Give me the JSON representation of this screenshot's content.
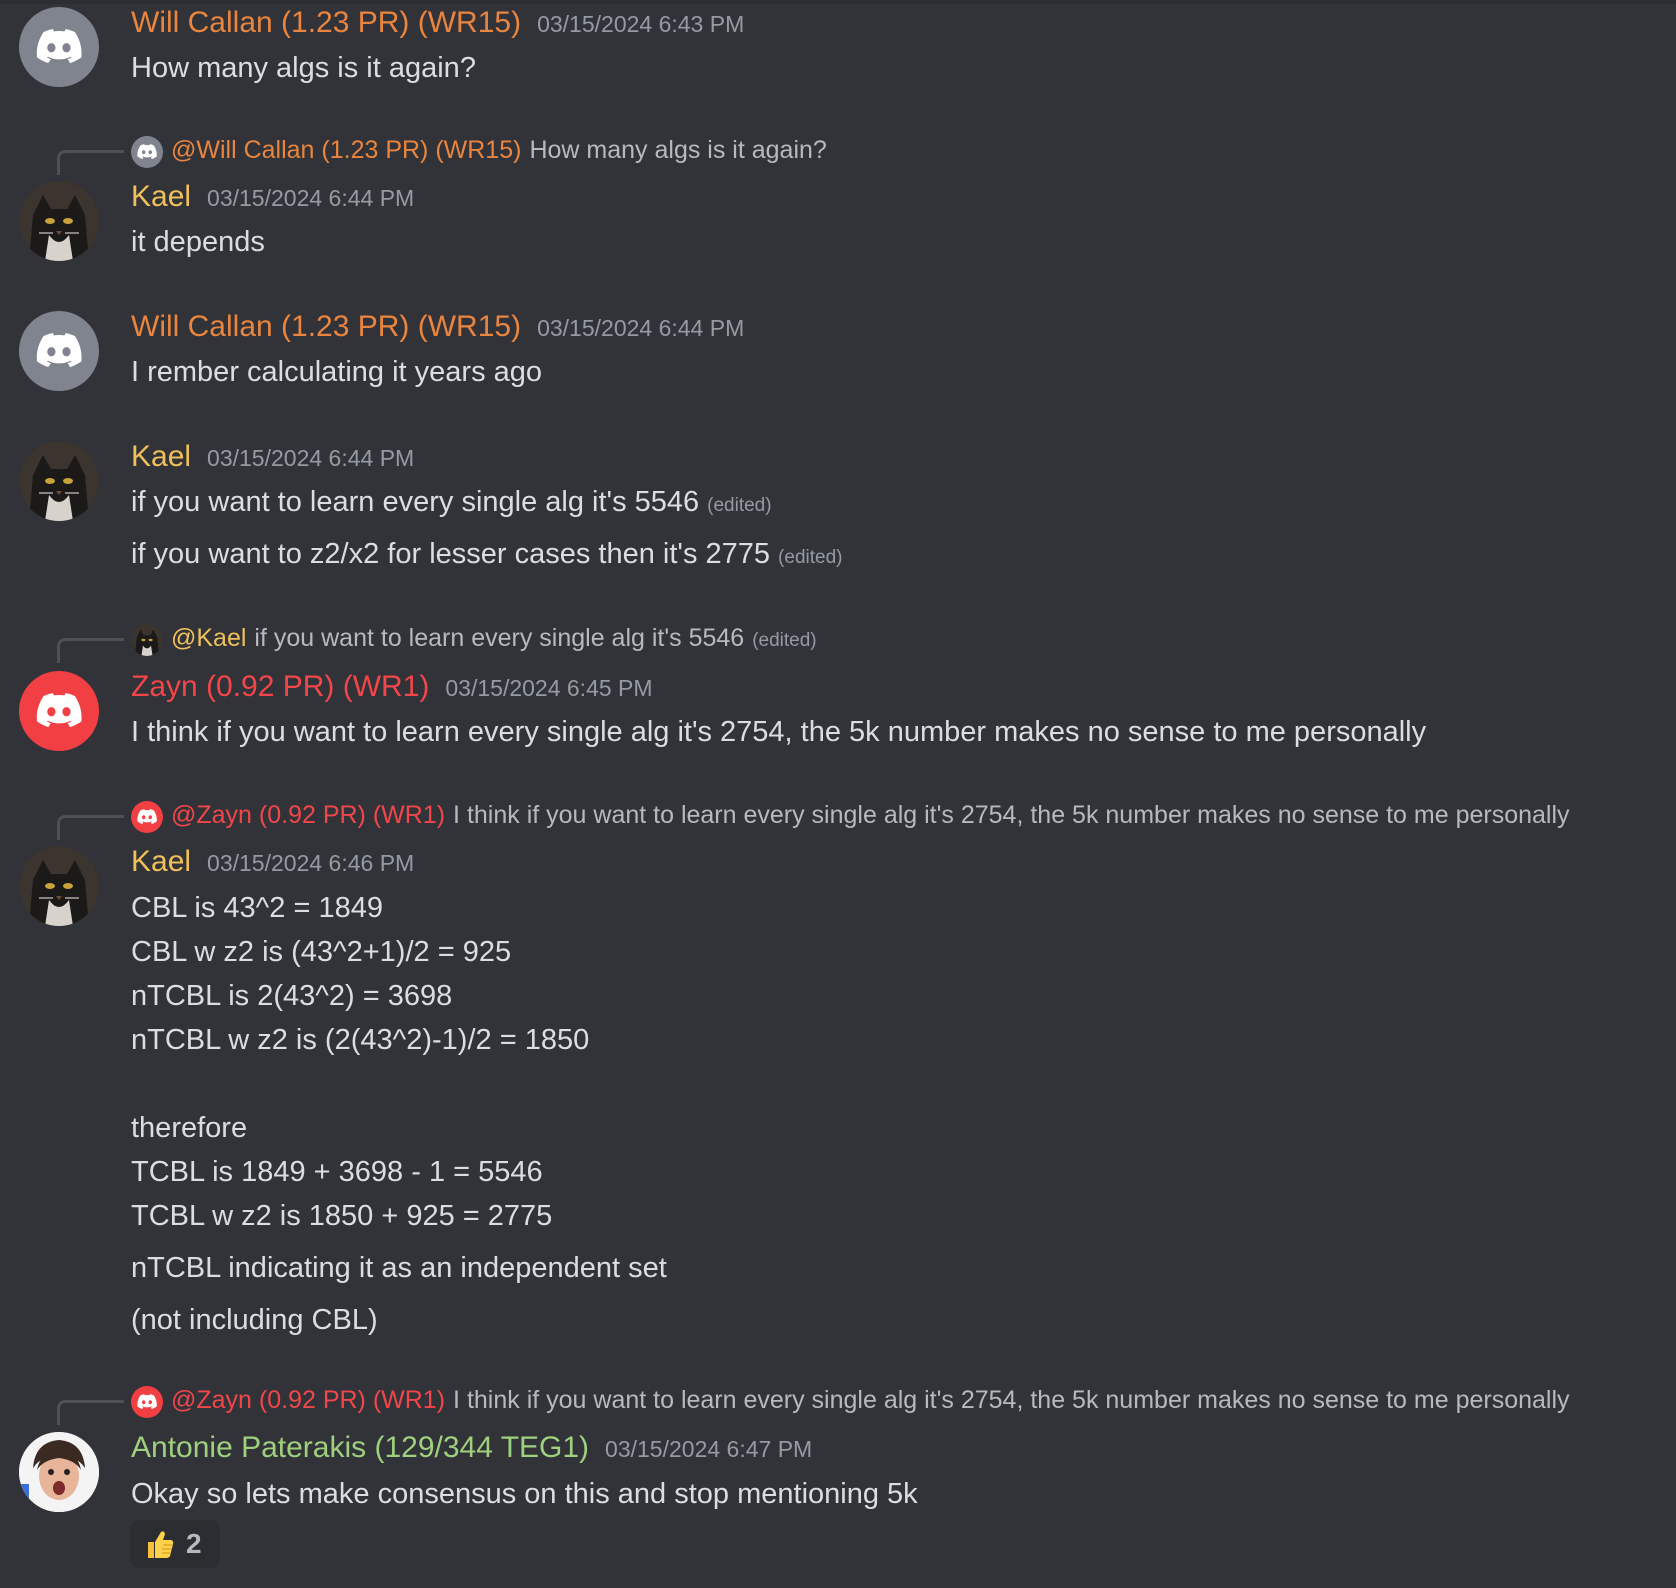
{
  "colors": {
    "will": "#e9853f",
    "kael": "#f0c05a",
    "zayn": "#f2464a",
    "antonie": "#9fd07d"
  },
  "msg1": {
    "author": "Will Callan (1.23 PR) (WR15)",
    "timestamp": "03/15/2024 6:43 PM",
    "lines": [
      "How many algs is it again?"
    ]
  },
  "msg2": {
    "reply": {
      "mention": "@Will Callan (1.23 PR) (WR15)",
      "text": "How many algs is it again?"
    },
    "author": "Kael",
    "timestamp": "03/15/2024 6:44 PM",
    "lines": [
      "it depends"
    ]
  },
  "msg3": {
    "author": "Will Callan (1.23 PR) (WR15)",
    "timestamp": "03/15/2024 6:44 PM",
    "lines": [
      "I rember calculating it years ago"
    ]
  },
  "msg4": {
    "author": "Kael",
    "timestamp": "03/15/2024 6:44 PM",
    "lines": [
      "if you want to learn every single alg it's 5546",
      "if you want to z2/x2 for lesser cases then it's 2775"
    ],
    "edited": "(edited)"
  },
  "msg5": {
    "reply": {
      "mention": "@Kael",
      "text": "if you want to learn every single alg it's 5546",
      "edited": "(edited)"
    },
    "author": "Zayn (0.92 PR) (WR1)",
    "timestamp": "03/15/2024 6:45 PM",
    "lines": [
      "I think if you want to learn every single alg it's 2754, the 5k number makes no sense to me personally"
    ]
  },
  "msg6": {
    "reply": {
      "mention": "@Zayn (0.92 PR) (WR1)",
      "text": "I think if you want to learn every single alg it's 2754, the 5k number makes no sense to me personally"
    },
    "author": "Kael",
    "timestamp": "03/15/2024 6:46 PM",
    "lines": [
      "CBL is 43^2 = 1849",
      "CBL w z2 is (43^2+1)/2 = 925",
      "nTCBL is 2(43^2) = 3698",
      "nTCBL w z2 is (2(43^2)-1)/2 = 1850",
      "therefore",
      "TCBL is 1849 + 3698 - 1 = 5546",
      "TCBL w z2 is 1850 + 925 = 2775",
      "nTCBL indicating it as an independent set",
      "(not including CBL)"
    ]
  },
  "msg7": {
    "reply": {
      "mention": "@Zayn (0.92 PR) (WR1)",
      "text": "I think if you want to learn every single alg it's 2754, the 5k number makes no sense to me personally"
    },
    "author": "Antonie Paterakis (129/344 TEG1)",
    "timestamp": "03/15/2024 6:47 PM",
    "lines": [
      "Okay so lets make consensus on this and stop mentioning 5k"
    ],
    "reaction": {
      "emoji": "thumbs-up",
      "count": "2"
    }
  }
}
